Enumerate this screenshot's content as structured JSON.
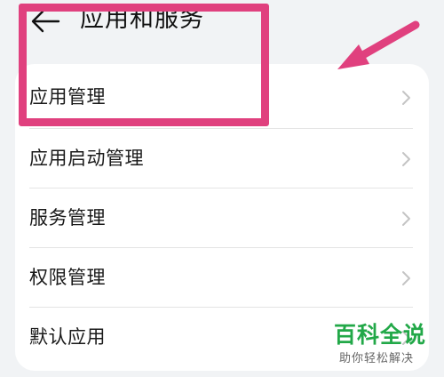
{
  "header": {
    "back_icon": "arrow-left-icon",
    "title": "应用和服务"
  },
  "menu": {
    "items": [
      {
        "label": "应用管理",
        "icon": "chevron-right-icon"
      },
      {
        "label": "应用启动管理",
        "icon": "chevron-right-icon"
      },
      {
        "label": "服务管理",
        "icon": "chevron-right-icon"
      },
      {
        "label": "权限管理",
        "icon": "chevron-right-icon"
      },
      {
        "label": "默认应用",
        "icon": "chevron-right-icon"
      }
    ]
  },
  "annotation": {
    "highlight_color": "#e0407e",
    "arrow_color": "#e0407e"
  },
  "watermark": {
    "title": "百科全说",
    "subtitle": "助你轻松解决",
    "title_color": "#22a848"
  },
  "colors": {
    "background": "#f1f3f5",
    "card": "#ffffff",
    "text": "#1a1a1a",
    "chevron": "#c4c4c4"
  }
}
